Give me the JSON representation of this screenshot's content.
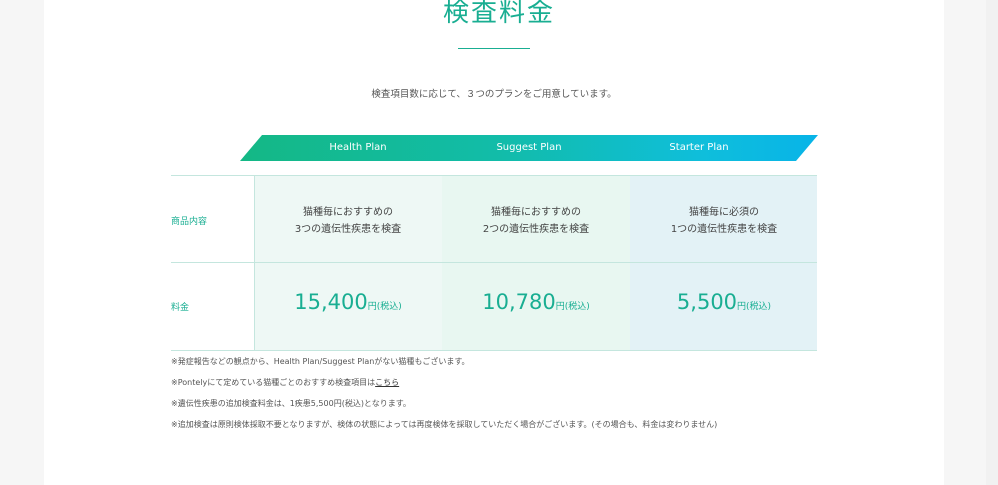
{
  "section": {
    "title": "検査料金",
    "lead": "検査項目数に応じて、３つのプランをご用意しています。"
  },
  "plans": [
    {
      "name": "Health Plan",
      "description_line1": "猫種毎におすすめの",
      "description_line2": "3つの遺伝性疾患を検査",
      "price": "15,400",
      "unit": "円(税込)",
      "bg": "#eef8f5"
    },
    {
      "name": "Suggest Plan",
      "description_line1": "猫種毎におすすめの",
      "description_line2": "2つの遺伝性疾患を検査",
      "price": "10,780",
      "unit": "円(税込)",
      "bg": "#e8f7f1"
    },
    {
      "name": "Starter Plan",
      "description_line1": "猫種毎に必須の",
      "description_line2": "1つの遺伝性疾患を検査",
      "price": "5,500",
      "unit": "円(税込)",
      "bg": "#e3f2f6"
    }
  ],
  "rows": {
    "content_label": "商品内容",
    "price_label": "料金"
  },
  "notes": {
    "n1": "※発症報告などの観点から、Health Plan/Suggest Planがない猫種もございます。",
    "n2_prefix": "※Pontelyにて定めている猫種ごとのおすすめ検査項目は",
    "n2_link": "こちら",
    "n3": "※遺伝性疾患の追加検査料金は、1疾患5,500円(税込)となります。",
    "n4": "※追加検査は原則検体採取不要となりますが、検体の状態によっては再度検体を採取していただく場合がございます。(その場合も、料金は変わりません)"
  },
  "colors": {
    "accent": "#19ae92",
    "banner_start": "#14b885",
    "banner_end": "#08b4e8"
  }
}
